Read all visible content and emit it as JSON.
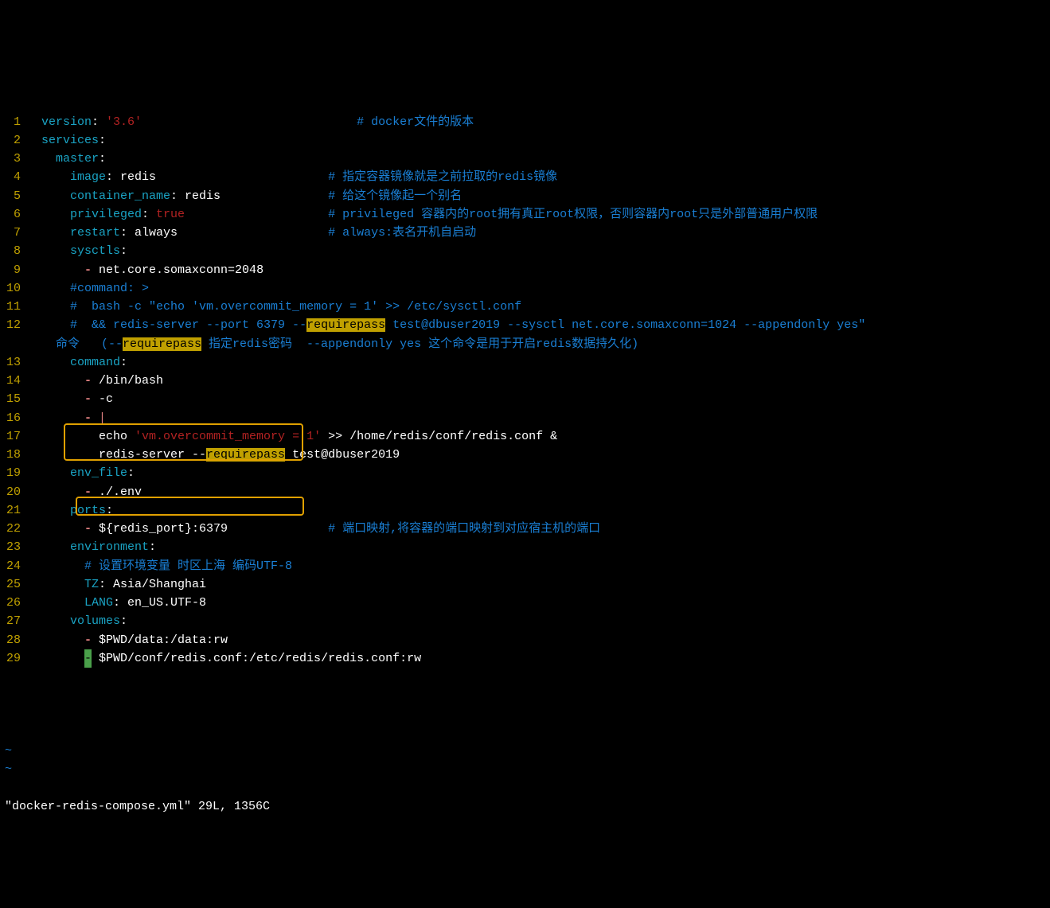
{
  "status": "\"docker-redis-compose.yml\" 29L, 1356C",
  "lines": [
    {
      "n": "1",
      "segs": [
        {
          "t": "  ",
          "c": "plain"
        },
        {
          "t": "version",
          "c": "key"
        },
        {
          "t": ": ",
          "c": "plain"
        },
        {
          "t": "'3.6'",
          "c": "str"
        },
        {
          "t": "                              ",
          "c": "plain"
        },
        {
          "t": "# docker文件的版本",
          "c": "comment"
        }
      ]
    },
    {
      "n": "2",
      "segs": [
        {
          "t": "  ",
          "c": "plain"
        },
        {
          "t": "services",
          "c": "key"
        },
        {
          "t": ":",
          "c": "plain"
        }
      ]
    },
    {
      "n": "3",
      "segs": [
        {
          "t": "    ",
          "c": "plain"
        },
        {
          "t": "master",
          "c": "key"
        },
        {
          "t": ":",
          "c": "plain"
        }
      ]
    },
    {
      "n": "4",
      "segs": [
        {
          "t": "      ",
          "c": "plain"
        },
        {
          "t": "image",
          "c": "key"
        },
        {
          "t": ": redis",
          "c": "plain"
        },
        {
          "t": "                        ",
          "c": "plain"
        },
        {
          "t": "# 指定容器镜像就是之前拉取的redis镜像",
          "c": "comment"
        }
      ]
    },
    {
      "n": "5",
      "segs": [
        {
          "t": "      ",
          "c": "plain"
        },
        {
          "t": "container_name",
          "c": "key"
        },
        {
          "t": ": redis",
          "c": "plain"
        },
        {
          "t": "               ",
          "c": "plain"
        },
        {
          "t": "# 给这个镜像起一个别名",
          "c": "comment"
        }
      ]
    },
    {
      "n": "6",
      "segs": [
        {
          "t": "      ",
          "c": "plain"
        },
        {
          "t": "privileged",
          "c": "key"
        },
        {
          "t": ": ",
          "c": "plain"
        },
        {
          "t": "true",
          "c": "booltrue"
        },
        {
          "t": "                    ",
          "c": "plain"
        },
        {
          "t": "# privileged 容器内的root拥有真正root权限，否则容器内root只是外部普通用户权限",
          "c": "comment"
        }
      ]
    },
    {
      "n": "7",
      "segs": [
        {
          "t": "      ",
          "c": "plain"
        },
        {
          "t": "restart",
          "c": "key"
        },
        {
          "t": ": always",
          "c": "plain"
        },
        {
          "t": "                     ",
          "c": "plain"
        },
        {
          "t": "# always:表名开机自启动",
          "c": "comment"
        }
      ]
    },
    {
      "n": "8",
      "segs": [
        {
          "t": "      ",
          "c": "plain"
        },
        {
          "t": "sysctls",
          "c": "key"
        },
        {
          "t": ":",
          "c": "plain"
        }
      ]
    },
    {
      "n": "9",
      "segs": [
        {
          "t": "        ",
          "c": "plain"
        },
        {
          "t": "- ",
          "c": "rose-b"
        },
        {
          "t": "net.core.somaxconn=2048",
          "c": "plain"
        }
      ]
    },
    {
      "n": "10",
      "segs": [
        {
          "t": "      ",
          "c": "plain"
        },
        {
          "t": "#command: >",
          "c": "comment"
        }
      ]
    },
    {
      "n": "11",
      "segs": [
        {
          "t": "      ",
          "c": "plain"
        },
        {
          "t": "#  bash -c \"echo 'vm.overcommit_memory = 1' >> /etc/sysctl.conf",
          "c": "comment"
        }
      ]
    },
    {
      "n": "12",
      "segs": [
        {
          "t": "      ",
          "c": "plain"
        },
        {
          "t": "#  && redis-server --port 6379 --",
          "c": "comment"
        },
        {
          "t": "requirepass",
          "c": "hl"
        },
        {
          "t": " test@dbuser2019 --sysctl net.core.somaxconn=1024 --appendonly yes\"",
          "c": "comment"
        }
      ]
    },
    {
      "n": "",
      "segs": [
        {
          "t": "    命令   (--",
          "c": "comment"
        },
        {
          "t": "requirepass",
          "c": "hl"
        },
        {
          "t": " 指定redis密码  --appendonly yes 这个命令是用于开启redis数据持久化)",
          "c": "comment"
        }
      ]
    },
    {
      "n": "13",
      "segs": [
        {
          "t": "      ",
          "c": "plain"
        },
        {
          "t": "command",
          "c": "key"
        },
        {
          "t": ":",
          "c": "plain"
        }
      ]
    },
    {
      "n": "14",
      "segs": [
        {
          "t": "        ",
          "c": "plain"
        },
        {
          "t": "- ",
          "c": "rose-b"
        },
        {
          "t": "/bin/bash",
          "c": "plain"
        }
      ]
    },
    {
      "n": "15",
      "segs": [
        {
          "t": "        ",
          "c": "plain"
        },
        {
          "t": "- ",
          "c": "rose-b"
        },
        {
          "t": "-c",
          "c": "plain"
        }
      ]
    },
    {
      "n": "16",
      "segs": [
        {
          "t": "        ",
          "c": "plain"
        },
        {
          "t": "- ",
          "c": "rose-b"
        },
        {
          "t": "|",
          "c": "rose"
        }
      ]
    },
    {
      "n": "17",
      "segs": [
        {
          "t": "          echo ",
          "c": "plain"
        },
        {
          "t": "'vm.overcommit_memory = 1'",
          "c": "str"
        },
        {
          "t": " >> /home/redis/conf/redis.conf &",
          "c": "plain"
        }
      ]
    },
    {
      "n": "18",
      "segs": [
        {
          "t": "          redis-server --",
          "c": "plain"
        },
        {
          "t": "requirepass",
          "c": "hl"
        },
        {
          "t": " test@dbuser2019",
          "c": "plain"
        }
      ]
    },
    {
      "n": "19",
      "segs": [
        {
          "t": "      ",
          "c": "plain"
        },
        {
          "t": "env_file",
          "c": "key"
        },
        {
          "t": ":",
          "c": "plain"
        }
      ]
    },
    {
      "n": "20",
      "segs": [
        {
          "t": "        ",
          "c": "plain"
        },
        {
          "t": "- ",
          "c": "rose-b"
        },
        {
          "t": "./.env",
          "c": "plain"
        }
      ]
    },
    {
      "n": "21",
      "segs": [
        {
          "t": "      ",
          "c": "plain"
        },
        {
          "t": "ports",
          "c": "key"
        },
        {
          "t": ":",
          "c": "plain"
        }
      ]
    },
    {
      "n": "22",
      "segs": [
        {
          "t": "        ",
          "c": "plain"
        },
        {
          "t": "- ",
          "c": "rose-b"
        },
        {
          "t": "${redis_port}:6379",
          "c": "plain"
        },
        {
          "t": "              ",
          "c": "plain"
        },
        {
          "t": "# 端口映射,将容器的端口映射到对应宿主机的端口",
          "c": "comment"
        }
      ]
    },
    {
      "n": "23",
      "segs": [
        {
          "t": "      ",
          "c": "plain"
        },
        {
          "t": "environment",
          "c": "key"
        },
        {
          "t": ":",
          "c": "plain"
        }
      ]
    },
    {
      "n": "24",
      "segs": [
        {
          "t": "        ",
          "c": "plain"
        },
        {
          "t": "# 设置环境变量 时区上海 编码UTF-8",
          "c": "comment"
        }
      ]
    },
    {
      "n": "25",
      "segs": [
        {
          "t": "        ",
          "c": "plain"
        },
        {
          "t": "TZ",
          "c": "key"
        },
        {
          "t": ": Asia/Shanghai",
          "c": "plain"
        }
      ]
    },
    {
      "n": "26",
      "segs": [
        {
          "t": "        ",
          "c": "plain"
        },
        {
          "t": "LANG",
          "c": "key"
        },
        {
          "t": ": en_US.UTF-8",
          "c": "plain"
        }
      ]
    },
    {
      "n": "27",
      "segs": [
        {
          "t": "      ",
          "c": "plain"
        },
        {
          "t": "volumes",
          "c": "key"
        },
        {
          "t": ":",
          "c": "plain"
        }
      ]
    },
    {
      "n": "28",
      "segs": [
        {
          "t": "        ",
          "c": "plain"
        },
        {
          "t": "- ",
          "c": "rose-b"
        },
        {
          "t": "$PWD/data:/data:rw",
          "c": "plain"
        }
      ]
    },
    {
      "n": "29",
      "segs": [
        {
          "t": "        ",
          "c": "plain"
        },
        {
          "t": "-",
          "c": "cursor"
        },
        {
          "t": " $PWD/conf/redis.conf:/etc/redis/redis.conf:rw",
          "c": "plain"
        }
      ]
    }
  ],
  "tildes": [
    "~",
    "~"
  ]
}
